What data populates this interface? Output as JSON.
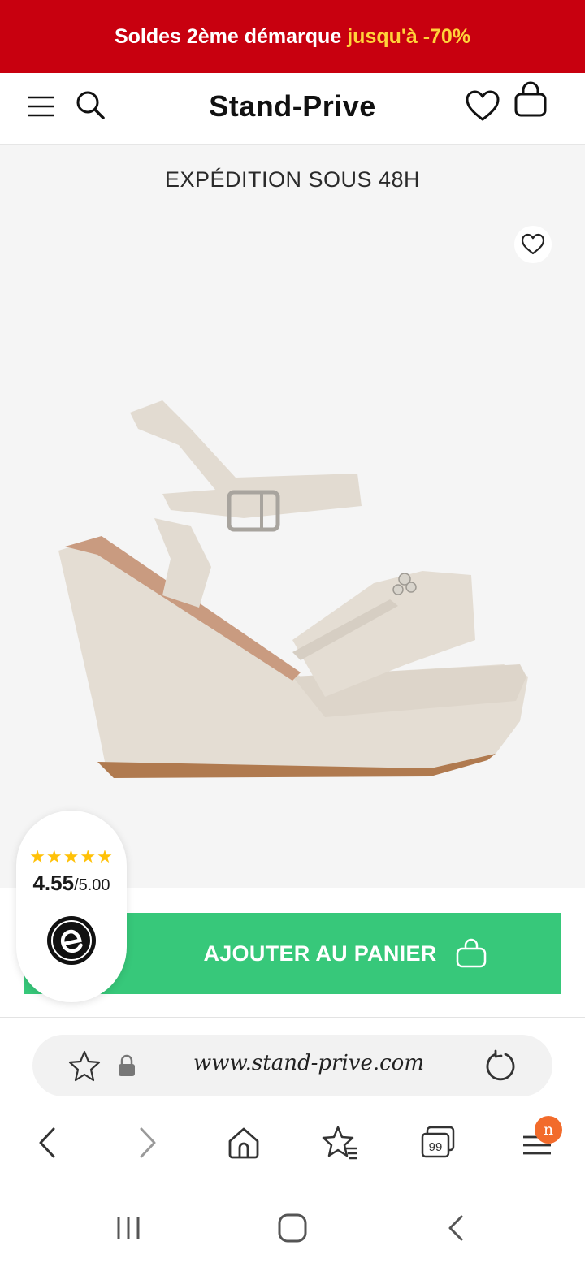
{
  "promo": {
    "text_main": "Soldes 2ème démarque",
    "text_highlight": "jusqu'à -70%",
    "bg_color": "#c8000f",
    "highlight_color": "#ffd23a"
  },
  "header": {
    "logo": "Stand-Prive",
    "icons": [
      "menu-icon",
      "search-icon",
      "heart-icon",
      "bag-icon"
    ]
  },
  "product": {
    "shipping_label": "EXPÉDITION SOUS 48H",
    "wishlist_icon": "heart-icon",
    "image": "beige-wedge-sandal"
  },
  "rating": {
    "stars": "★★★★★",
    "value": "4.55",
    "max": "/5.00",
    "star_fill_fraction": 0.91,
    "provider_icon": "trusted-shops-e-icon"
  },
  "cart_button": {
    "label": "AJOUTER AU PANIER",
    "color": "#37c87a",
    "icon": "bag-icon"
  },
  "browser": {
    "url": "www.stand-prive.com",
    "tab_count": "99",
    "menu_badge": "n",
    "badge_color": "#f26b2b",
    "nav_icons": [
      "back-icon",
      "forward-icon",
      "home-icon",
      "bookmarks-icon",
      "tabs-icon",
      "menu-icon"
    ]
  },
  "system_nav": {
    "icons": [
      "recent-apps-icon",
      "home-icon",
      "back-icon"
    ]
  }
}
